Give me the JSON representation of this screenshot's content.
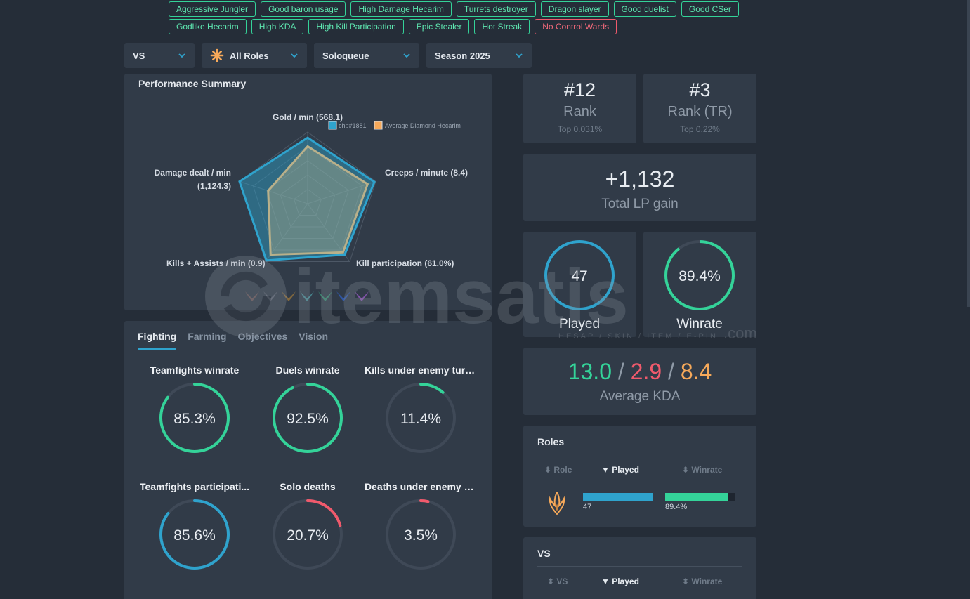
{
  "tags": {
    "row1": [
      "Aggressive Jungler",
      "Good baron usage",
      "High Damage Hecarim",
      "Turrets destroyer",
      "Dragon slayer",
      "Good duelist",
      "Good CSer"
    ],
    "row2": [
      "Godlike Hecarim",
      "High KDA",
      "High Kill Participation",
      "Epic Stealer",
      "Hot Streak"
    ],
    "row2_bad": "No Control Wards"
  },
  "filters": {
    "vs": "VS",
    "roles": "All Roles",
    "queue": "Soloqueue",
    "season": "Season 2025"
  },
  "performance": {
    "title": "Performance Summary",
    "legend_player": "chp#1881",
    "legend_avg": "Average Diamond Hecarim",
    "axes": {
      "gold": "Gold / min (568.1)",
      "creeps": "Creeps / minute (8.4)",
      "kp": "Kill participation (61.0%)",
      "ka": "Kills + Assists / min (0.9)",
      "dmg1": "Damage dealt / min",
      "dmg2": "(1,124.3)"
    },
    "player_values": [
      0.92,
      0.98,
      0.88,
      0.98,
      1.0
    ],
    "avg_values": [
      0.8,
      0.88,
      0.84,
      0.88,
      0.58
    ]
  },
  "rank": {
    "num": "#12",
    "label": "Rank",
    "top": "Top 0.031%"
  },
  "rank_tr": {
    "num": "#3",
    "label": "Rank (TR)",
    "top": "Top 0.22%"
  },
  "lp": {
    "value": "+1,132",
    "label": "Total LP gain"
  },
  "played": {
    "value": "47",
    "label": "Played"
  },
  "winrate": {
    "value": "89.4%",
    "label": "Winrate",
    "pct": 89.4
  },
  "kda": {
    "kills": "13.0",
    "deaths": "2.9",
    "assists": "8.4",
    "sep": "/",
    "label": "Average KDA"
  },
  "fighting": {
    "tabs": [
      "Fighting",
      "Farming",
      "Objectives",
      "Vision"
    ],
    "metrics": [
      {
        "label": "Teamfights winrate",
        "value": "85.3%",
        "pct": 85.3,
        "color": "#34d399"
      },
      {
        "label": "Duels winrate",
        "value": "92.5%",
        "pct": 92.5,
        "color": "#34d399"
      },
      {
        "label": "Kills under enemy turret",
        "value": "11.4%",
        "pct": 11.4,
        "color": "#34d399"
      },
      {
        "label": "Teamfights participati...",
        "value": "85.6%",
        "pct": 85.6,
        "color": "#2fa3cd"
      },
      {
        "label": "Solo deaths",
        "value": "20.7%",
        "pct": 20.7,
        "color": "#f05a6c"
      },
      {
        "label": "Deaths under enemy tur...",
        "value": "3.5%",
        "pct": 3.5,
        "color": "#f05a6c"
      }
    ]
  },
  "roles": {
    "title": "Roles",
    "col_role": "Role",
    "col_played": "Played",
    "col_winrate": "Winrate",
    "played_value": "47",
    "played_pct": 100,
    "winrate_value": "89.4%",
    "winrate_pct": 89.4
  },
  "vs_table": {
    "title": "VS",
    "col_vs": "VS",
    "col_played": "Played",
    "col_winrate": "Winrate"
  },
  "watermark": {
    "brand": "itemsatis",
    "sub": "HESAP / SKIN / ITEM / E-PIN",
    "tld": ".com"
  },
  "colors": {
    "green": "#34d399",
    "blue": "#2fa3cd",
    "red": "#f05a6c",
    "orange": "#f6a95a"
  }
}
